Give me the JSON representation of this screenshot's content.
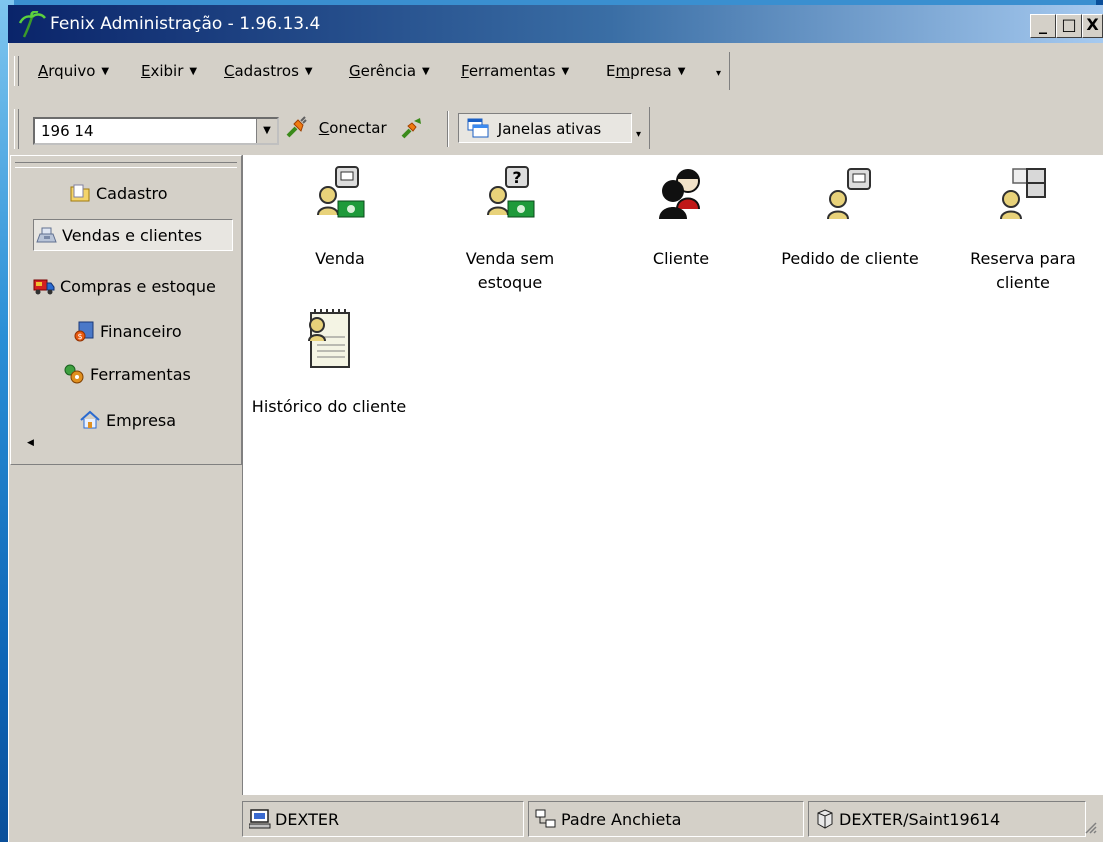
{
  "window": {
    "title": "Fenix Administração - 1.96.13.4",
    "controls": {
      "minimize": "_",
      "maximize": "□",
      "close": "X"
    }
  },
  "menu": [
    {
      "label": "Arquivo",
      "key": "A",
      "rest": "rquivo"
    },
    {
      "label": "Exibir",
      "key": "E",
      "rest": "xibir"
    },
    {
      "label": "Cadastros",
      "key": "C",
      "rest": "adastros"
    },
    {
      "label": "Gerência",
      "key": "G",
      "rest": "erência"
    },
    {
      "label": "Ferramentas",
      "key": "F",
      "rest": "erramentas"
    },
    {
      "label": "Empresa",
      "key": "m",
      "pre": "E",
      "rest": "presa"
    }
  ],
  "toolbar": {
    "combo_value": "196 14",
    "connect": {
      "key": "C",
      "rest": "onectar"
    },
    "active_windows": "Janelas ativas"
  },
  "sidebar": {
    "items": [
      {
        "label": "Cadastro",
        "icon": "folder-icon"
      },
      {
        "label": "Vendas e clientes",
        "icon": "cash-register-icon",
        "active": true
      },
      {
        "label": "Compras e estoque",
        "icon": "truck-icon"
      },
      {
        "label": "Financeiro",
        "icon": "money-bag-icon"
      },
      {
        "label": "Ferramentas",
        "icon": "gears-icon"
      },
      {
        "label": "Empresa",
        "icon": "house-icon"
      }
    ]
  },
  "content": {
    "tiles": [
      {
        "label": "Venda",
        "icon": "sale-icon"
      },
      {
        "label": "Venda sem estoque",
        "icon": "sale-no-stock-icon"
      },
      {
        "label": "Cliente",
        "icon": "customers-icon"
      },
      {
        "label": "Pedido de cliente",
        "icon": "customer-order-icon"
      },
      {
        "label": "Reserva para cliente",
        "icon": "customer-reservation-icon"
      },
      {
        "label": "Histórico do cliente",
        "icon": "customer-history-icon"
      }
    ]
  },
  "status": {
    "computer": "DEXTER",
    "branch": "Padre Anchieta",
    "database": "DEXTER/Saint19614"
  },
  "colors": {
    "titlebar_start": "#0a246a",
    "titlebar_end": "#a6caf0",
    "face": "#d4d0c8",
    "content_bg": "#ffffff"
  }
}
